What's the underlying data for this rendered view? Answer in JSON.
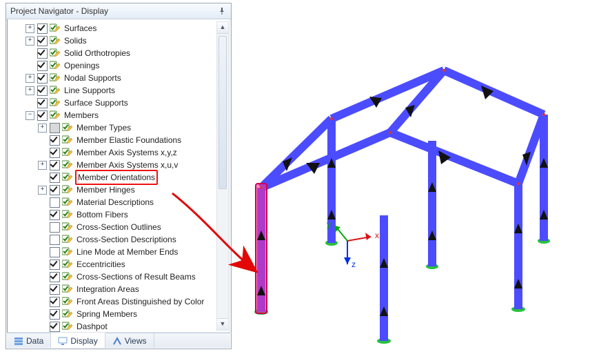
{
  "panel": {
    "title": "Project Navigator - Display"
  },
  "tree": [
    {
      "indent": 1,
      "toggle": "+",
      "checked": true,
      "icon": "checkpencil",
      "label": "Surfaces"
    },
    {
      "indent": 1,
      "toggle": "+",
      "checked": true,
      "icon": "checkpencil",
      "label": "Solids"
    },
    {
      "indent": 1,
      "toggle": " ",
      "checked": true,
      "icon": "checkpencil",
      "label": "Solid Orthotropies"
    },
    {
      "indent": 1,
      "toggle": " ",
      "checked": true,
      "icon": "checkpencil",
      "label": "Openings"
    },
    {
      "indent": 1,
      "toggle": "+",
      "checked": true,
      "icon": "checkpencil",
      "label": "Nodal Supports"
    },
    {
      "indent": 1,
      "toggle": "+",
      "checked": true,
      "icon": "checkpencil",
      "label": "Line Supports"
    },
    {
      "indent": 1,
      "toggle": " ",
      "checked": true,
      "icon": "checkpencil",
      "label": "Surface Supports"
    },
    {
      "indent": 1,
      "toggle": "-",
      "checked": true,
      "icon": "checkpencil",
      "label": "Members"
    },
    {
      "indent": 2,
      "toggle": "+",
      "checked": "half",
      "icon": "checkpencil",
      "label": "Member Types"
    },
    {
      "indent": 2,
      "toggle": " ",
      "checked": true,
      "icon": "checkpencil",
      "label": "Member Elastic Foundations"
    },
    {
      "indent": 2,
      "toggle": " ",
      "checked": true,
      "icon": "checkpencil",
      "label": "Member Axis Systems x,y,z"
    },
    {
      "indent": 2,
      "toggle": "+",
      "checked": true,
      "icon": "checkpencil",
      "label": "Member Axis Systems x,u,v"
    },
    {
      "indent": 2,
      "toggle": " ",
      "checked": true,
      "icon": "checkpencil",
      "label": "Member Orientations",
      "highlight": true
    },
    {
      "indent": 2,
      "toggle": "+",
      "checked": true,
      "icon": "checkpencil",
      "label": "Member Hinges"
    },
    {
      "indent": 2,
      "toggle": " ",
      "checked": false,
      "icon": "checkpencil",
      "label": "Material Descriptions"
    },
    {
      "indent": 2,
      "toggle": " ",
      "checked": true,
      "icon": "checkpencil",
      "label": "Bottom Fibers"
    },
    {
      "indent": 2,
      "toggle": " ",
      "checked": false,
      "icon": "checkpencil",
      "label": "Cross-Section Outlines"
    },
    {
      "indent": 2,
      "toggle": " ",
      "checked": false,
      "icon": "checkpencil",
      "label": "Cross-Section Descriptions"
    },
    {
      "indent": 2,
      "toggle": " ",
      "checked": false,
      "icon": "checkpencil",
      "label": "Line Mode at Member Ends"
    },
    {
      "indent": 2,
      "toggle": " ",
      "checked": true,
      "icon": "checkpencil",
      "label": "Eccentricities"
    },
    {
      "indent": 2,
      "toggle": " ",
      "checked": true,
      "icon": "checkpencil",
      "label": "Cross-Sections of Result Beams"
    },
    {
      "indent": 2,
      "toggle": " ",
      "checked": true,
      "icon": "checkpencil",
      "label": "Integration Areas"
    },
    {
      "indent": 2,
      "toggle": " ",
      "checked": true,
      "icon": "checkpencil",
      "label": "Front Areas Distinguished by Color"
    },
    {
      "indent": 2,
      "toggle": " ",
      "checked": true,
      "icon": "checkpencil",
      "label": "Spring Members"
    },
    {
      "indent": 2,
      "toggle": " ",
      "checked": true,
      "icon": "checkpencil",
      "label": "Dashpot"
    }
  ],
  "tabs": [
    {
      "label": "Data",
      "icon": "data",
      "active": false
    },
    {
      "label": "Display",
      "icon": "display",
      "active": true
    },
    {
      "label": "Views",
      "icon": "views",
      "active": false
    }
  ],
  "axes": {
    "x": "x",
    "y": "y",
    "z": "z"
  },
  "colors": {
    "member": "#4c4cff",
    "memberEdge": "#1a1acc",
    "arrowFill": "#111",
    "highlightFill": "#ff2e9a",
    "highlightStroke": "#d0004f",
    "supportGreen": "#27c23b",
    "callout": "#e20808"
  },
  "chart_data": {
    "type": "diagram",
    "description": "3D wireframe/solid view of a simple portal-frame structure. Six vertical columns on green pinned supports, two longitudinal eave beams, two gable rafters per frame meeting at a ridge, and one ridge beam. Black triangular arrows along each member show member local x-axis orientation. The front-left column is shown with a magenta highlight rectangle as the target of the red callout arrow from the tree item 'Member Orientations'. A small XYZ coordinate triad is drawn near the center of the view.",
    "columns": 6,
    "rafters_per_frame": 2,
    "frames": 2,
    "ridge_beams": 1,
    "eave_beams": 2
  }
}
